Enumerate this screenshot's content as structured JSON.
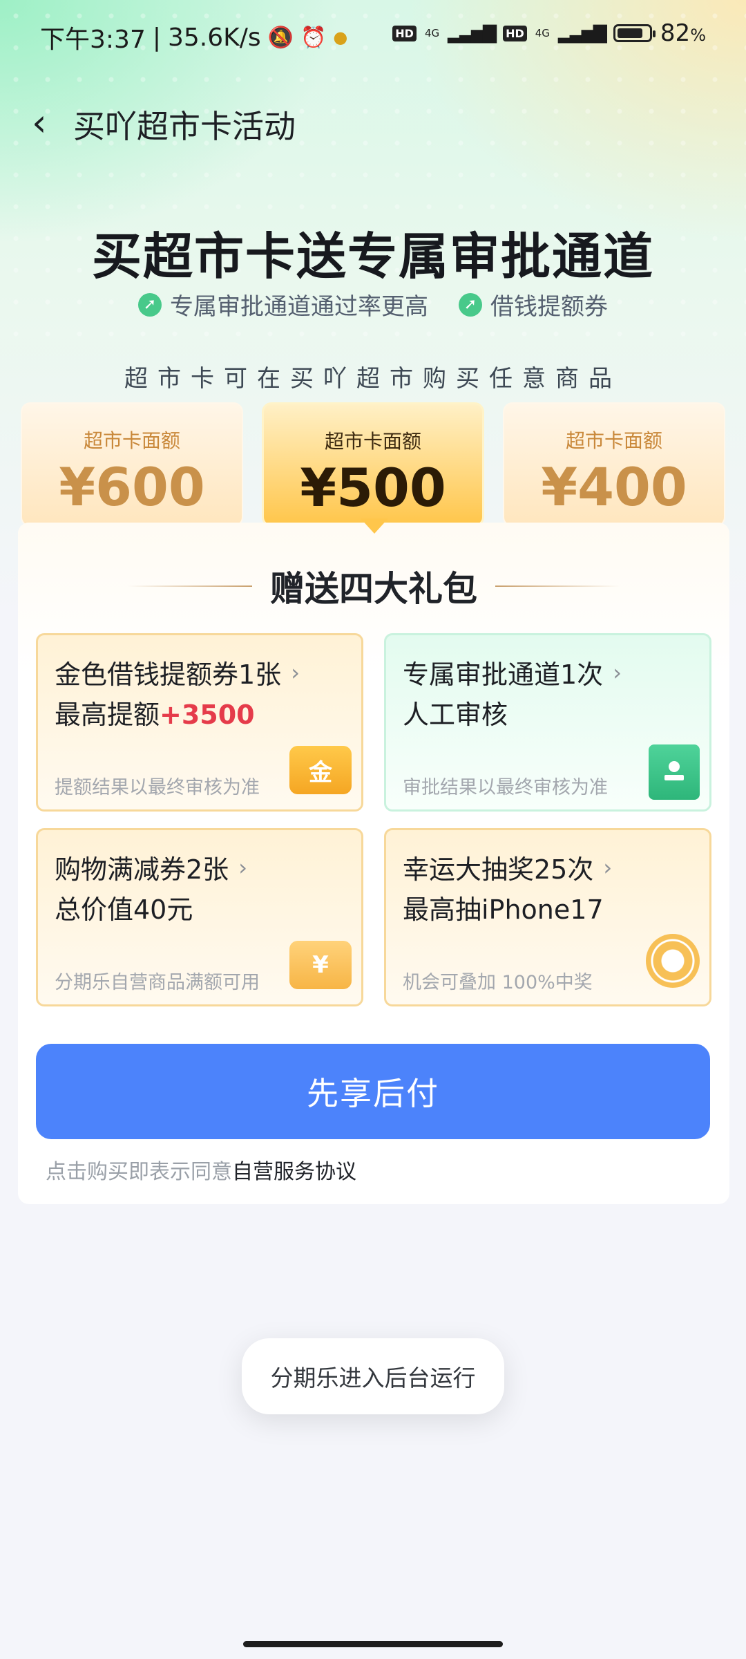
{
  "status_bar": {
    "time": "下午3:37",
    "network_speed": "35.6K/s",
    "battery": "82",
    "battery_unit": "%",
    "hd_label": "HD",
    "net_label": "4G",
    "battery_level": 0.82
  },
  "nav": {
    "back_icon": "chevron-left-icon",
    "title": "买吖超市卡活动"
  },
  "hero": {
    "headline": "买超市卡送专属审批通道",
    "features": [
      "专属审批通道通过率更高",
      "借钱提额券"
    ],
    "subtitle": "超市卡可在买吖超市购买任意商品"
  },
  "cards": [
    {
      "label": "超市卡面额",
      "amount": "¥600",
      "selected": false
    },
    {
      "label": "超市卡面额",
      "amount": "¥500",
      "selected": true
    },
    {
      "label": "超市卡面额",
      "amount": "¥400",
      "selected": false
    }
  ],
  "gifts": {
    "title": "赠送四大礼包",
    "items": [
      {
        "line1": "金色借钱提额券1张",
        "line2_prefix": "最高提额",
        "line2_highlight": "+3500",
        "note": "提额结果以最终审核为准",
        "icon": "coupon-gold-icon",
        "icon_text": "金"
      },
      {
        "line1": "专属审批通道1次",
        "line2_prefix": "人工审核",
        "line2_highlight": "",
        "note": "审批结果以最终审核为准",
        "icon": "stamp-icon",
        "icon_text": ""
      },
      {
        "line1": "购物满减券2张",
        "line2_prefix": "总价值40元",
        "line2_highlight": "",
        "note": "分期乐自营商品满额可用",
        "icon": "yen-ticket-icon",
        "icon_text": "¥"
      },
      {
        "line1": "幸运大抽奖25次",
        "line2_prefix": "最高抽iPhone17",
        "line2_highlight": "",
        "note": "机会可叠加 100%中奖",
        "icon": "lottery-wheel-icon",
        "icon_text": ""
      }
    ]
  },
  "cta": {
    "label": "先享后付"
  },
  "agreement": {
    "prefix": "点击购买即表示同意",
    "link": "自营服务协议"
  },
  "toast": {
    "text": "分期乐进入后台运行"
  },
  "colors": {
    "accent": "#4c83fb",
    "highlight": "#e53b4a",
    "gold": "#ffc64b"
  }
}
